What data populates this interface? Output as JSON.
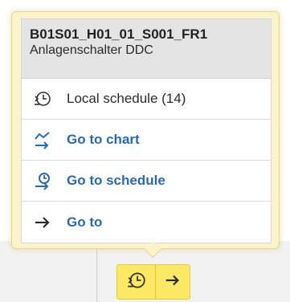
{
  "popup": {
    "title": "B01S01_H01_01_S001_FR1",
    "subtitle": "Anlagenschalter DDC",
    "items": [
      {
        "label": "Local schedule (14)",
        "icon": "local-schedule-icon",
        "style": "plain"
      },
      {
        "label": "Go to chart",
        "icon": "chart-icon",
        "style": "link"
      },
      {
        "label": "Go to schedule",
        "icon": "schedule-link-icon",
        "style": "link"
      },
      {
        "label": "Go to",
        "icon": "arrow-right-icon",
        "style": "link"
      }
    ]
  },
  "toolbar": {
    "schedule_icon": "schedule-icon",
    "goto_icon": "arrow-right-icon"
  },
  "colors": {
    "popup_bg": "#fbf3cc",
    "popup_border": "#e6d78e",
    "link": "#2a6ab5",
    "header_bg": "#e4e4e4",
    "trigger_bg": "#fbe864"
  }
}
